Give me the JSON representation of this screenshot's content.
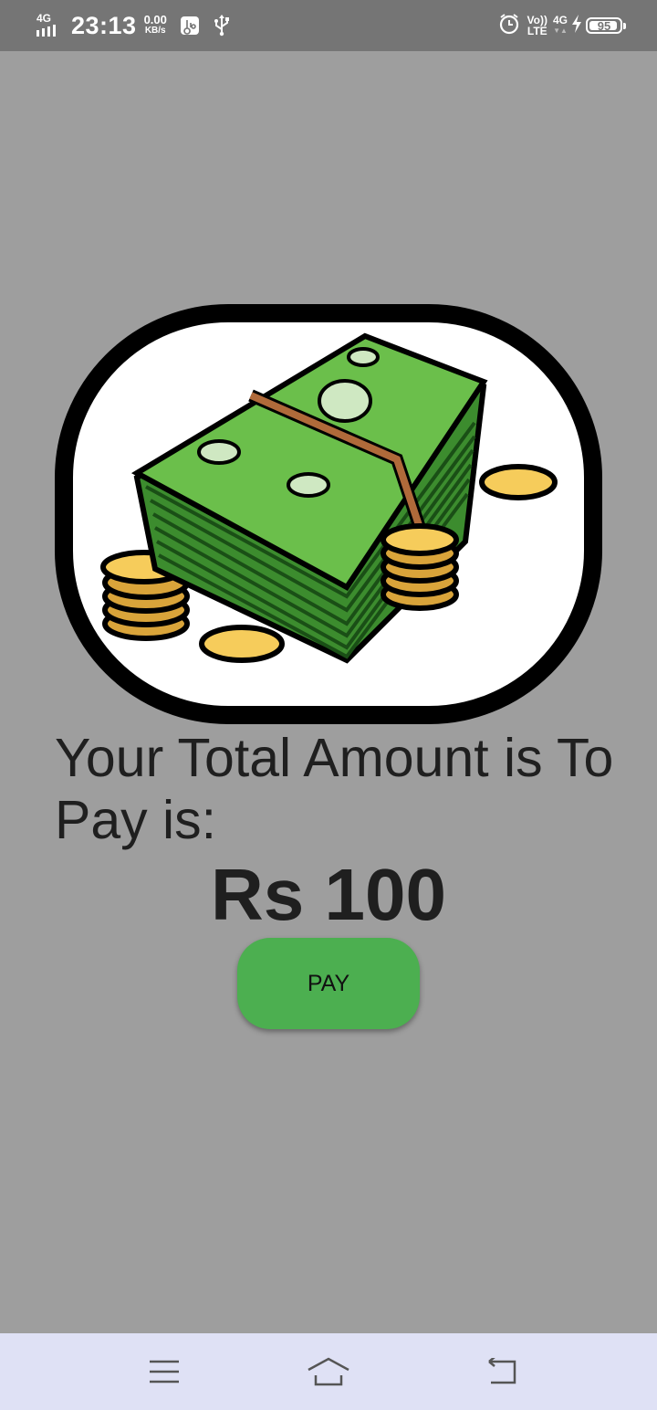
{
  "status_bar": {
    "network_type": "4G",
    "time": "23:13",
    "speed_value": "0.00",
    "speed_unit": "KB/s",
    "volte_top": "Vo))",
    "volte_bottom": "LTE",
    "data_type": "4G",
    "battery": "95",
    "battery_level": 0.95,
    "icons": [
      "signal-icon",
      "usb-debug-icon",
      "usb-icon",
      "alarm-icon",
      "volte-icon",
      "charging-icon",
      "battery-icon"
    ]
  },
  "main": {
    "image": "money-stack-with-coins",
    "total_label": "Your Total Amount is To Pay is:",
    "amount": "Rs 100",
    "pay_button_label": "PAY"
  },
  "nav_bar": {
    "icons": [
      "menu-icon",
      "home-icon",
      "back-icon"
    ]
  },
  "colors": {
    "background": "#9e9e9e",
    "status_bar": "#757575",
    "pay_button": "#4caf50",
    "nav_bar": "#dfe1f5",
    "text": "#1f1f1f"
  }
}
